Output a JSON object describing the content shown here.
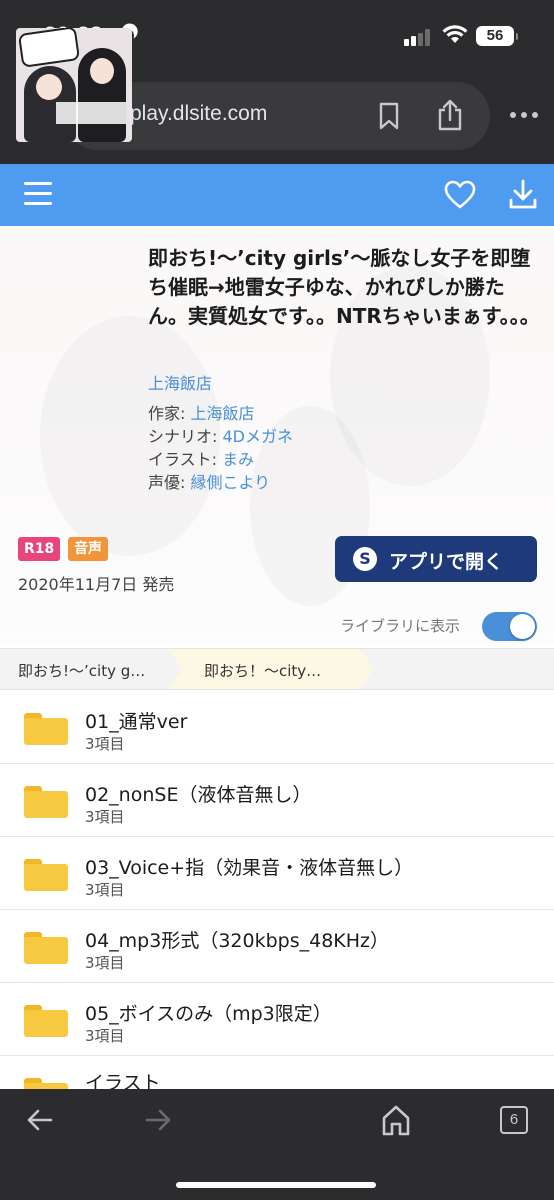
{
  "status_bar": {
    "time": "20:38",
    "battery": "56"
  },
  "browser": {
    "url": "play.dlsite.com",
    "tab_count": "6"
  },
  "work": {
    "title": "即おち!〜’city girls’〜脈なし女子を即堕ち催眠→地雷女子ゆな、かれぴしか勝たん。実質処女です。。NTRちゃいまぁす。。。",
    "circle": "上海飯店",
    "credits": [
      {
        "label": "作家: ",
        "value": "上海飯店"
      },
      {
        "label": "シナリオ: ",
        "value": "4Dメガネ"
      },
      {
        "label": "イラスト: ",
        "value": "まみ"
      },
      {
        "label": "声優: ",
        "value": "縁側こより"
      }
    ],
    "tags": [
      "R18",
      "音声"
    ],
    "release_date": "2020年11月7日 発売",
    "open_app_label": "アプリで開く",
    "library_label": "ライブラリに表示",
    "library_visible": true
  },
  "breadcrumb": {
    "items": [
      "即おち!〜’city g…",
      "即おち！〜city…"
    ]
  },
  "folders": [
    {
      "name": "01_通常ver",
      "count": "3項目"
    },
    {
      "name": "02_nonSE（液体音無し）",
      "count": "3項目"
    },
    {
      "name": "03_Voice+指（効果音・液体音無し）",
      "count": "3項目"
    },
    {
      "name": "04_mp3形式（320kbps_48KHz）",
      "count": "3項目"
    },
    {
      "name": "05_ボイスのみ（mp3限定）",
      "count": "3項目"
    },
    {
      "name": "イラスト",
      "count": ""
    }
  ],
  "colors": {
    "header_blue": "#4f9bf0",
    "link_blue": "#4a90d9",
    "app_button_navy": "#1e3a7a",
    "tag_r18": "#e8457a",
    "tag_voice": "#f0953a",
    "folder_yellow": "#f7c940"
  },
  "icons": {
    "browser_close": "close-icon",
    "lock": "lock-icon",
    "bookmark": "bookmark-icon",
    "share": "share-icon",
    "menu": "hamburger-menu-icon",
    "favorite": "heart-icon",
    "download": "download-icon",
    "folder": "folder-icon",
    "back": "arrow-left-icon",
    "forward": "arrow-right-icon",
    "home": "home-icon"
  }
}
